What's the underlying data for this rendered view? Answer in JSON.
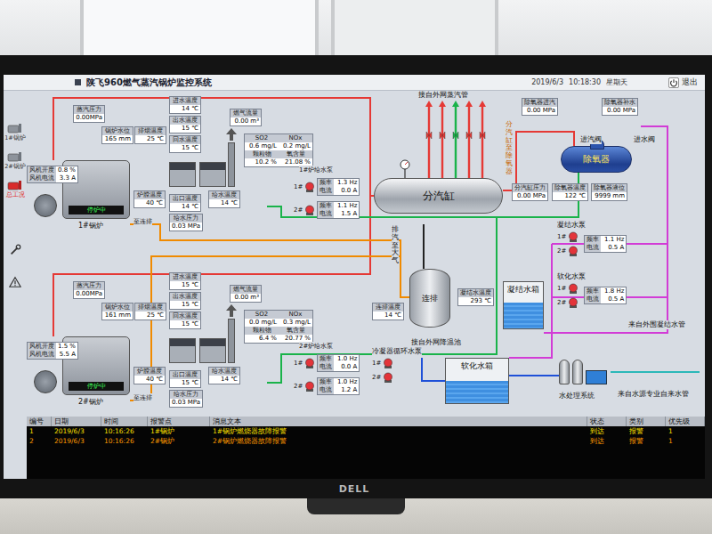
{
  "photo": {
    "monitor_logo": "DELL"
  },
  "window": {
    "title": "陕飞960燃气蒸汽锅炉监控系统",
    "date": "2019/6/3",
    "time": "10:18:30",
    "weekday": "星期天",
    "exit": "退出"
  },
  "sidebar": {
    "nav": [
      {
        "label": "1#锅炉",
        "kind": "boiler",
        "selected": false
      },
      {
        "label": "2#锅炉",
        "kind": "boiler",
        "selected": false
      },
      {
        "label": "总工况",
        "kind": "overview",
        "selected": true
      }
    ],
    "tools": [
      {
        "kind": "trend"
      },
      {
        "kind": "alarm"
      }
    ]
  },
  "pump_labels": {
    "freq": "频率",
    "current": "电流"
  },
  "boilers": [
    {
      "name": "1#锅炉",
      "status": "停炉中",
      "drain": "至连排",
      "readings": [
        {
          "label": "蒸汽压力",
          "value": "0.00MPa"
        },
        {
          "label": "锅炉水位",
          "value": "165 mm"
        },
        {
          "label": "排烟温度",
          "value": "25 ℃"
        },
        {
          "label": "进水温度",
          "value": "14 ℃"
        },
        {
          "label": "出水温度",
          "value": "15 ℃"
        },
        {
          "label": "回水温度",
          "value": "15 ℃"
        },
        {
          "label": "炉膛温度",
          "value": "40 ℃"
        },
        {
          "label": "出口温度",
          "value": "14 ℃"
        },
        {
          "label": "给水压力",
          "value": "0.03 MPa"
        },
        {
          "label": "给水温度",
          "value": "14 ℃"
        },
        {
          "label": "燃气流量",
          "value": "0.00 m³"
        }
      ],
      "fan": [
        {
          "label": "风机开度",
          "value": "0.8 %"
        },
        {
          "label": "风机电流",
          "value": "3.3 A"
        }
      ],
      "emissions": [
        {
          "label": "SO2",
          "value": "0.6 mg/L"
        },
        {
          "label": "NOx",
          "value": "0.2 mg/L"
        },
        {
          "label": "颗粒物",
          "value": "10.2 %"
        },
        {
          "label": "氧含量",
          "value": "21.08 %"
        }
      ],
      "pump_group": "1#炉给水泵",
      "pumps": [
        {
          "name": "1#",
          "running": false,
          "freq": "1.3 Hz",
          "current": "0.0 A"
        },
        {
          "name": "2#",
          "running": false,
          "freq": "1.1 Hz",
          "current": "1.5 A"
        }
      ]
    },
    {
      "name": "2#锅炉",
      "status": "停炉中",
      "drain": "至连排",
      "readings": [
        {
          "label": "蒸汽压力",
          "value": "0.00MPa"
        },
        {
          "label": "锅炉水位",
          "value": "161 mm"
        },
        {
          "label": "排烟温度",
          "value": "25 ℃"
        },
        {
          "label": "进水温度",
          "value": "15 ℃"
        },
        {
          "label": "出水温度",
          "value": "15 ℃"
        },
        {
          "label": "回水温度",
          "value": "15 ℃"
        },
        {
          "label": "炉膛温度",
          "value": "40 ℃"
        },
        {
          "label": "出口温度",
          "value": "15 ℃"
        },
        {
          "label": "给水压力",
          "value": "0.03 MPa"
        },
        {
          "label": "给水温度",
          "value": "14 ℃"
        },
        {
          "label": "燃气流量",
          "value": "0.00 m³"
        }
      ],
      "fan": [
        {
          "label": "风机开度",
          "value": "1.5 %"
        },
        {
          "label": "风机电流",
          "value": "5.5 A"
        }
      ],
      "emissions": [
        {
          "label": "SO2",
          "value": "0.0 mg/L"
        },
        {
          "label": "NOx",
          "value": "0.3 mg/L"
        },
        {
          "label": "颗粒物",
          "value": "6.4 %"
        },
        {
          "label": "氧含量",
          "value": "20.77 %"
        }
      ],
      "pump_group": "2#炉给水泵",
      "pumps": [
        {
          "name": "1#",
          "running": false,
          "freq": "1.0 Hz",
          "current": "0.0 A"
        },
        {
          "name": "2#",
          "running": false,
          "freq": "1.0 Hz",
          "current": "1.2 A"
        }
      ]
    }
  ],
  "plant": {
    "labels": [
      {
        "text": "接自外网蒸汽管"
      },
      {
        "text": "接自外网降温池"
      },
      {
        "text": "来自外围凝结水管"
      },
      {
        "text": "来自水源专业自来水管"
      },
      {
        "text": "水处理系统"
      },
      {
        "text": "进汽阀"
      },
      {
        "text": "进水阀"
      }
    ],
    "vertical_labels": [
      {
        "text": "排汽至大气"
      },
      {
        "text": "分汽缸至除氧器"
      }
    ],
    "vessels": [
      {
        "name": "分汽缸",
        "kind": "header"
      },
      {
        "name": "连排",
        "kind": "flash"
      },
      {
        "name": "凝结水箱",
        "kind": "tank",
        "level": 0.55
      },
      {
        "name": "软化水箱",
        "kind": "tank",
        "level": 0.5
      },
      {
        "name": "除氧器",
        "kind": "drum"
      }
    ],
    "readings": [
      {
        "label": "分汽缸压力",
        "value": "0.00 MPa"
      },
      {
        "label": "连排温度",
        "value": "14 ℃"
      },
      {
        "label": "凝结水温度",
        "value": "293 ℃"
      },
      {
        "label": "除氧器进汽",
        "value": "0.00 MPa"
      },
      {
        "label": "除氧器补水",
        "value": "0.00 MPa"
      },
      {
        "label": "除氧器温度",
        "value": "122 ℃"
      },
      {
        "label": "除氧器液位",
        "value": "9999 mm"
      }
    ],
    "pump_groups": [
      {
        "name": "凝结水泵",
        "pumps": [
          {
            "name": "1#",
            "running": false
          },
          {
            "name": "2#",
            "running": false
          }
        ],
        "freq": "1.1 Hz",
        "current": "0.5 A"
      },
      {
        "name": "软化水泵",
        "pumps": [
          {
            "name": "1#",
            "running": false
          },
          {
            "name": "2#",
            "running": false
          }
        ],
        "freq": "1.8 Hz",
        "current": "0.5 A"
      },
      {
        "name": "冷凝器循环水泵",
        "pumps": [
          {
            "name": "1#",
            "running": false
          },
          {
            "name": "2#",
            "running": false
          }
        ]
      }
    ]
  },
  "alarms": {
    "columns": [
      "编号",
      "日期",
      "时间",
      "报警点",
      "消息文本",
      "状态",
      "类别",
      "优先级"
    ],
    "rows": [
      {
        "cells": [
          "1",
          "2019/6/3",
          "10:16:26",
          "1#锅炉",
          "1#锅炉燃烧器故障报警",
          "到达",
          "报警",
          "1"
        ],
        "color": "#ffe000"
      },
      {
        "cells": [
          "2",
          "2019/6/3",
          "10:16:26",
          "2#锅炉",
          "2#锅炉燃烧器故障报警",
          "到达",
          "报警",
          "1"
        ],
        "color": "#ff9c00"
      }
    ]
  }
}
